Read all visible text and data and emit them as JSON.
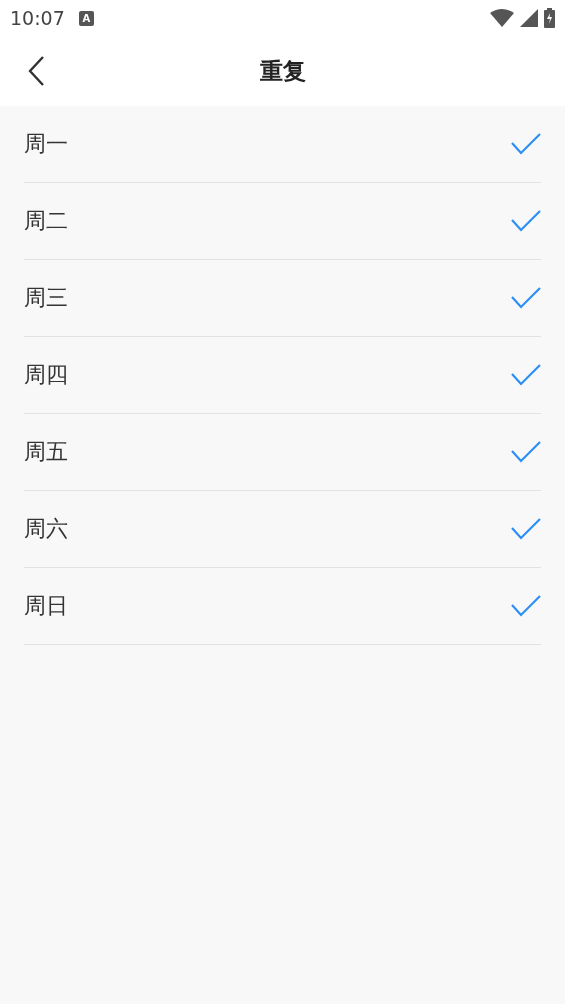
{
  "status_bar": {
    "time": "10:07",
    "notification_icon_text": "A"
  },
  "header": {
    "title": "重复"
  },
  "days": [
    {
      "label": "周一",
      "checked": true
    },
    {
      "label": "周二",
      "checked": true
    },
    {
      "label": "周三",
      "checked": true
    },
    {
      "label": "周四",
      "checked": true
    },
    {
      "label": "周五",
      "checked": true
    },
    {
      "label": "周六",
      "checked": true
    },
    {
      "label": "周日",
      "checked": true
    }
  ]
}
